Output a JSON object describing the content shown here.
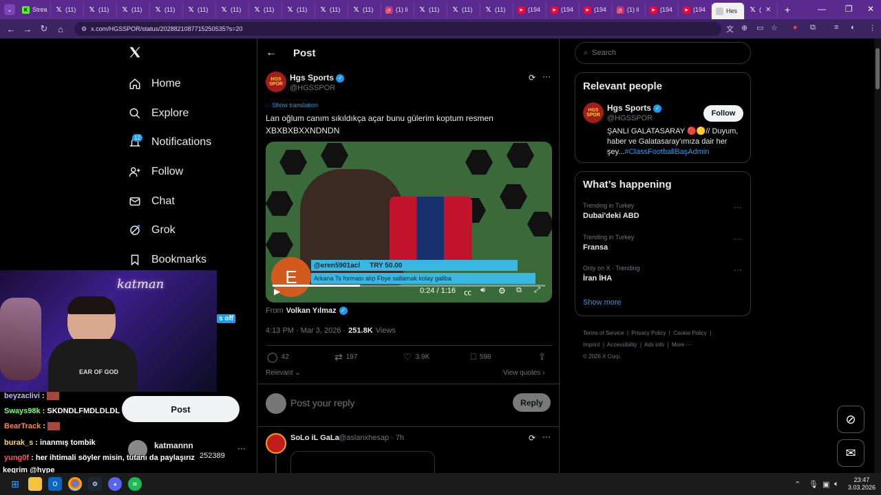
{
  "browser": {
    "tabs": [
      {
        "icon": "kick-icon",
        "label": "Strea"
      },
      {
        "icon": "x-icon",
        "label": "(11)"
      },
      {
        "icon": "x-icon",
        "label": "(11)"
      },
      {
        "icon": "x-icon",
        "label": "(11)"
      },
      {
        "icon": "x-icon",
        "label": "(11)"
      },
      {
        "icon": "x-icon",
        "label": "(11)"
      },
      {
        "icon": "x-icon",
        "label": "(11)"
      },
      {
        "icon": "x-icon",
        "label": "(11)"
      },
      {
        "icon": "x-icon",
        "label": "(11)"
      },
      {
        "icon": "x-icon",
        "label": "(11)"
      },
      {
        "icon": "x-icon",
        "label": "(11)"
      },
      {
        "icon": "instagram-icon",
        "label": "(1) li"
      },
      {
        "icon": "x-icon",
        "label": "(11)"
      },
      {
        "icon": "x-icon",
        "label": "(11)"
      },
      {
        "icon": "x-icon",
        "label": "(11)"
      },
      {
        "icon": "youtube-icon",
        "label": "(194"
      },
      {
        "icon": "youtube-icon",
        "label": "(194"
      },
      {
        "icon": "youtube-icon",
        "label": "(194"
      },
      {
        "icon": "instagram-icon",
        "label": "(1) li"
      },
      {
        "icon": "youtube-icon",
        "label": "(194"
      },
      {
        "icon": "youtube-icon",
        "label": "(194"
      },
      {
        "icon": "doc-icon",
        "label": "Hes"
      },
      {
        "icon": "x-icon",
        "label": "("
      }
    ],
    "url": "x.com/HGSSPOR/status/2028821087715250535?s=20",
    "clock_time": "23:47",
    "clock_date": "3.03.2026"
  },
  "sidebar": {
    "items": [
      {
        "label": "Home",
        "icon": "home-icon"
      },
      {
        "label": "Explore",
        "icon": "search-icon"
      },
      {
        "label": "Notifications",
        "icon": "bell-icon"
      },
      {
        "label": "Follow",
        "icon": "person-add-icon"
      },
      {
        "label": "Chat",
        "icon": "mail-icon"
      },
      {
        "label": "Grok",
        "icon": "grok-icon"
      },
      {
        "label": "Bookmarks",
        "icon": "bookmark-icon"
      }
    ],
    "notif_count": "12",
    "post_button": "Post",
    "account_name": "katmannn",
    "account_handle": "252389",
    "partial_text": "s off"
  },
  "post": {
    "header_title": "Post",
    "author_name": "Hgs Sports",
    "author_handle": "@HGSSPOR",
    "avatar_text": "HGS SPOR",
    "show_translation": "Show translation",
    "text": "Lan oğlum canım sıkıldıkça açar bunu gülerim koptum resmen XBXBXBXXNDNDN",
    "video": {
      "donor": "@eren5901acl",
      "amount": "TRY 50.00",
      "message": "Arkana Ts forması alıp Fbye sallamak kolay galiba",
      "avatar_letter": "E",
      "time": "0:24 / 1:16"
    },
    "from_prefix": "From",
    "from_name": "Volkan Yılmaz",
    "timestamp": "4:13 PM · Mar 3, 2026 ·",
    "views_count": "251.8K",
    "views_label": "Views",
    "replies": "42",
    "reposts": "197",
    "likes": "3.9K",
    "bookmarks": "598",
    "sort_label": "Relevant",
    "view_quotes": "View quotes",
    "reply_placeholder": "Post your reply",
    "reply_button": "Reply",
    "reply_author": "SoLo iL GaLa",
    "reply_meta": "@aslanxhesap · 7h"
  },
  "right": {
    "search_placeholder": "Search",
    "relevant_title": "Relevant people",
    "person_name": "Hgs Sports",
    "person_handle": "@HGSSPOR",
    "follow_button": "Follow",
    "bio": "ŞANLI GALATASARAY 🔴🟡// Duyum, haber ve Galatasaray'ımıza dair her şey...",
    "bio_link": "#ClassFootballBaşAdmin",
    "happening_title": "What’s happening",
    "trends": [
      {
        "context": "Trending in Turkey",
        "name": "Dubai'deki ABD"
      },
      {
        "context": "Trending in Turkey",
        "name": "Fransa"
      },
      {
        "context": "Only on X · Trending",
        "name": "İran İHA"
      }
    ],
    "show_more": "Show more",
    "footer": [
      "Terms of Service",
      "Privacy Policy",
      "Cookie Policy",
      "Imprint",
      "Accessibility",
      "Ads info",
      "More ···",
      "© 2026 X Corp."
    ]
  },
  "stream": {
    "overlay_brand": "katman",
    "shirt_text": "EAR OF GOD",
    "chat": [
      {
        "user": "beyzaclivi",
        "color": "#c9b2ff",
        "text": ""
      },
      {
        "user": "Sways98k",
        "color": "#7dff6b",
        "text": "SKDNDLFMDLDLDL"
      },
      {
        "user": "BearTrack",
        "color": "#ff8a3d",
        "text": ""
      },
      {
        "user": "burak_s",
        "color": "#ffd84a",
        "text": "inanmış tombik"
      },
      {
        "user": "yung0f",
        "color": "#ff5a5a",
        "text": "her ihtimali söyler misin, tutanı da paylaşırız"
      },
      {
        "user": "",
        "color": "#ffffff",
        "text": "kegrim @hype"
      }
    ]
  }
}
